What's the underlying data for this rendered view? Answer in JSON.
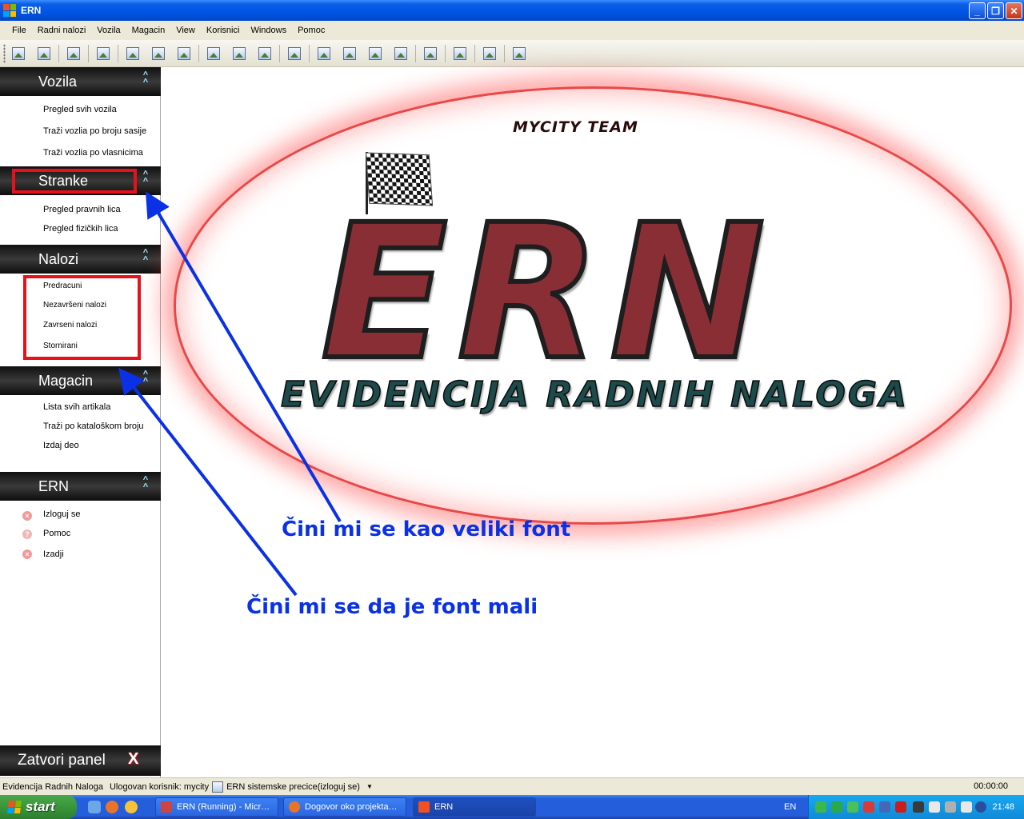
{
  "window": {
    "title": "ERN",
    "minimize_label": "_",
    "restore_label": "❐",
    "close_label": "✕"
  },
  "menu": [
    "File",
    "Radni nalozi",
    "Vozila",
    "Magacin",
    "View",
    "Korisnici",
    "Windows",
    "Pomoc"
  ],
  "toolbar_icon": "image-icon",
  "panel": {
    "groups": [
      {
        "title": "Vozila",
        "items": [
          "Pregled svih vozila",
          "Traži vozlia po broju sasije",
          "Traži vozlia po vlasnicima"
        ]
      },
      {
        "title": "Stranke",
        "items": [
          "Pregled pravnih lica",
          "Pregled fizičkih lica"
        ]
      },
      {
        "title": "Nalozi",
        "items": [
          "Predracuni",
          "Nezavršeni nalozi",
          "Zavrseni nalozi",
          "Stornirani"
        ]
      },
      {
        "title": "Magacin",
        "items": [
          "Lista svih artikala",
          "Traži po kataloškom broju",
          "Izdaj deo"
        ]
      },
      {
        "title": "ERN",
        "items": [
          "Izloguj se",
          "Pomoc",
          "Izadji"
        ]
      }
    ],
    "close_label": "Zatvori panel",
    "close_x": "X"
  },
  "logo": {
    "team": "MYCITY TEAM",
    "name": "ERN",
    "subtitle": "EVIDENCIJA RADNIH NALOGA"
  },
  "annotations": {
    "big_font": "Čini mi se kao veliki font",
    "small_font": "Čini mi se da je font mali",
    "color": "#0a31e6",
    "box_color": "#e8101a"
  },
  "status": {
    "app": "Evidencija Radnih Naloga",
    "user": "Ulogovan korisnik: mycity",
    "shortcuts": "ERN sistemske precice(izloguj se)",
    "timer": "00:00:00"
  },
  "taskbar": {
    "start": "start",
    "tasks": [
      "ERN (Running) - Micr…",
      "Dogovor oko projekta…",
      "ERN"
    ],
    "lang": "EN",
    "clock": "21:48"
  }
}
